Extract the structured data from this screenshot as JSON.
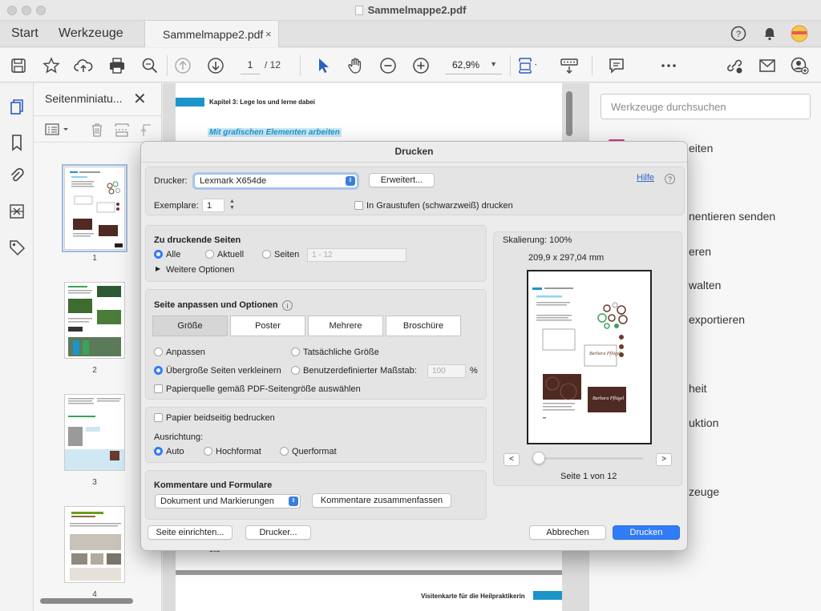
{
  "window": {
    "title": "Sammelmappe2.pdf"
  },
  "tabs": {
    "start": "Start",
    "tools": "Werkzeuge",
    "doc_tab": "Sammelmappe2.pdf",
    "close": "×"
  },
  "toolbar": {
    "page_current": "1",
    "page_total": "/ 12",
    "zoom": "62,9%"
  },
  "thumbnails": {
    "title": "Seitenminiatu...",
    "close": "✕",
    "pages": [
      {
        "label": "1"
      },
      {
        "label": "2"
      },
      {
        "label": "3"
      },
      {
        "label": "4"
      }
    ]
  },
  "document": {
    "header": "Kapitel 3: Lege los und lerne dabei",
    "highlight": "Mit grafischen Elementen arbeiten",
    "footer_right": "Visitenkarte für die Heilpraktikerin",
    "page_number": "102",
    "accent": "#1b95c9"
  },
  "right_panel": {
    "search_placeholder": "Werkzeuge durchsuchen",
    "items": [
      "eiten",
      "nentieren senden",
      "eren",
      "walten",
      "exportieren",
      "heit",
      "uktion",
      "zeuge"
    ]
  },
  "dialog": {
    "title": "Drucken",
    "printer_label": "Drucker:",
    "printer_value": "Lexmark X654de",
    "advanced_button": "Erweitert...",
    "help_link": "Hilfe",
    "copies_label": "Exemplare:",
    "copies_value": "1",
    "grayscale_label": "In Graustufen (schwarzweiß) drucken",
    "pages_section": {
      "title": "Zu druckende Seiten",
      "all": "Alle",
      "current": "Aktuell",
      "pages": "Seiten",
      "range_placeholder": "1 - 12",
      "more_options": "Weitere Optionen"
    },
    "fit_section": {
      "title": "Seite anpassen und Optionen",
      "segments": [
        "Größe",
        "Poster",
        "Mehrere",
        "Broschüre"
      ],
      "fit": "Anpassen",
      "actual_size": "Tatsächliche Größe",
      "shrink": "Übergroße Seiten verkleinern",
      "custom_scale": "Benutzerdefinierter Maßstab:",
      "custom_scale_value": "100",
      "percent": "%",
      "paper_source": "Papierquelle gemäß PDF-Seitengröße auswählen"
    },
    "duplex_section": {
      "duplex_label": "Papier beidseitig bedrucken",
      "orientation_label": "Ausrichtung:",
      "auto": "Auto",
      "portrait": "Hochformat",
      "landscape": "Querformat"
    },
    "comments_section": {
      "title": "Kommentare und Formulare",
      "select_value": "Dokument und Markierungen",
      "summarize_button": "Kommentare zusammenfassen"
    },
    "preview": {
      "scale": "Skalierung: 100%",
      "size": "209,9 x 297,04 mm",
      "prev": "<",
      "next": ">",
      "page_info": "Seite 1 von 12"
    },
    "footer": {
      "page_setup": "Seite einrichten...",
      "printer": "Drucker...",
      "cancel": "Abbrechen",
      "print": "Drucken"
    },
    "primary_color": "#2f7cf6"
  }
}
